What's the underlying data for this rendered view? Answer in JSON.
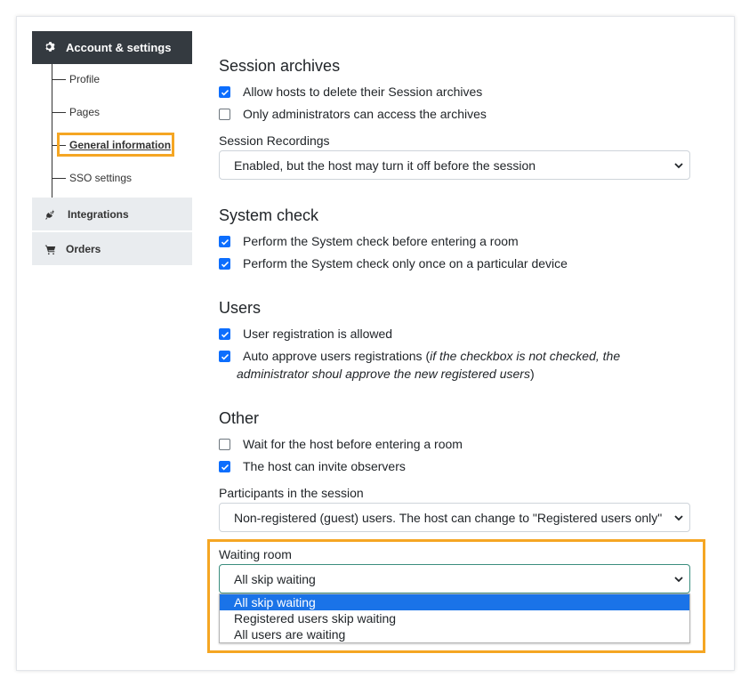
{
  "sidebar": {
    "header_label": "Account & settings",
    "header_icon": "gear-icon",
    "sub_items": [
      {
        "label": "Profile"
      },
      {
        "label": "Pages"
      },
      {
        "label": "General information",
        "active": true
      },
      {
        "label": "SSO settings"
      }
    ],
    "integrations_label": "Integrations",
    "integrations_icon": "plug-icon",
    "orders_label": "Orders",
    "orders_icon": "cart-icon"
  },
  "session_archives": {
    "title": "Session archives",
    "options": [
      {
        "label": "Allow hosts to delete their Session archives",
        "checked": true
      },
      {
        "label": "Only administrators can access the archives",
        "checked": false
      }
    ],
    "recordings_label": "Session Recordings",
    "recordings_value": "Enabled, but the host may turn it off before the session"
  },
  "system_check": {
    "title": "System check",
    "options": [
      {
        "label": "Perform the System check before entering a room",
        "checked": true
      },
      {
        "label": "Perform the System check only once on a particular device",
        "checked": true
      }
    ]
  },
  "users": {
    "title": "Users",
    "options": [
      {
        "label": "User registration is allowed",
        "checked": true
      },
      {
        "label_prefix": "Auto approve users registrations (",
        "label_italic_1": "if the checkbox is not checked, the",
        "label_italic_2": "administrator shoul approve the new registered users",
        "label_suffix": ")",
        "checked": true
      }
    ]
  },
  "other": {
    "title": "Other",
    "options": [
      {
        "label": "Wait for the host before entering a room",
        "checked": false
      },
      {
        "label": "The host can invite observers",
        "checked": true
      }
    ],
    "participants_label": "Participants in the session",
    "participants_value": "Non-registered (guest) users. The host can change to \"Registered users only\" b",
    "waiting_room_label": "Waiting room",
    "waiting_room_value": "All skip waiting",
    "waiting_room_options": [
      {
        "label": "All skip waiting",
        "selected": true
      },
      {
        "label": "Registered users skip waiting",
        "selected": false
      },
      {
        "label": "All users are waiting",
        "selected": false
      }
    ]
  },
  "colors": {
    "highlight": "#f5a623",
    "checkbox": "#0d6efd",
    "selected_option": "#1a73e8",
    "sidebar_header": "#343a40"
  }
}
